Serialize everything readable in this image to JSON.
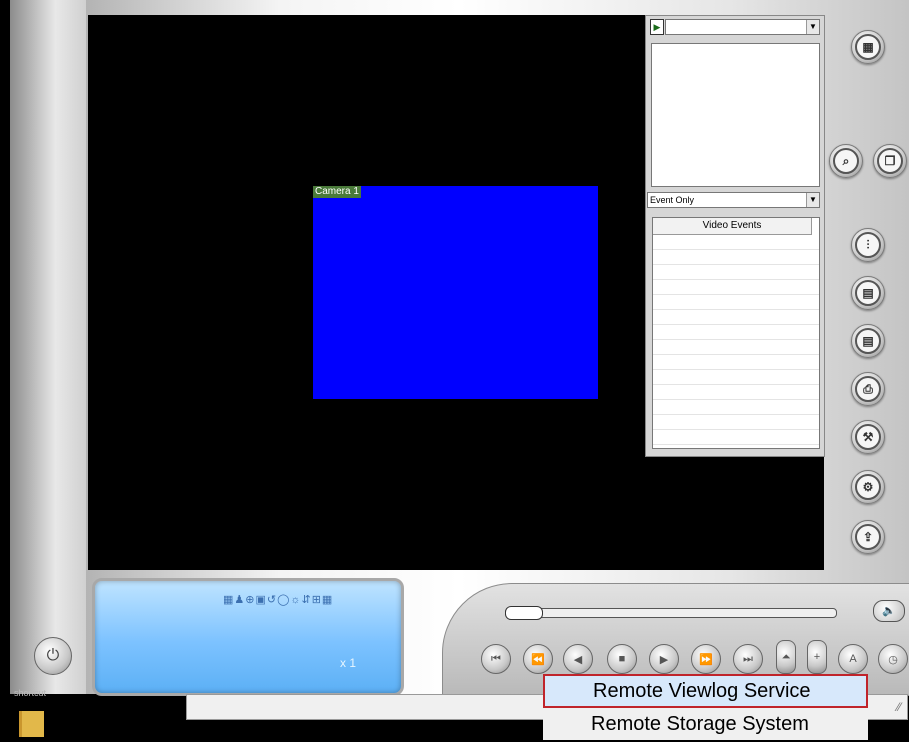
{
  "video": {
    "camera_label": "Camera 1"
  },
  "side_panel": {
    "top_select_value": "",
    "event_filter_value": "Event Only",
    "events_header": "Video Events"
  },
  "lcd": {
    "status_icons": "▦♟⊕▣↺◯☼⇵⊞▦",
    "speed": "x 1"
  },
  "context_menu": {
    "items": [
      "Remote Viewlog Service",
      "Remote Storage System"
    ]
  },
  "desktop": {
    "shortcut_label": "shortcut"
  }
}
